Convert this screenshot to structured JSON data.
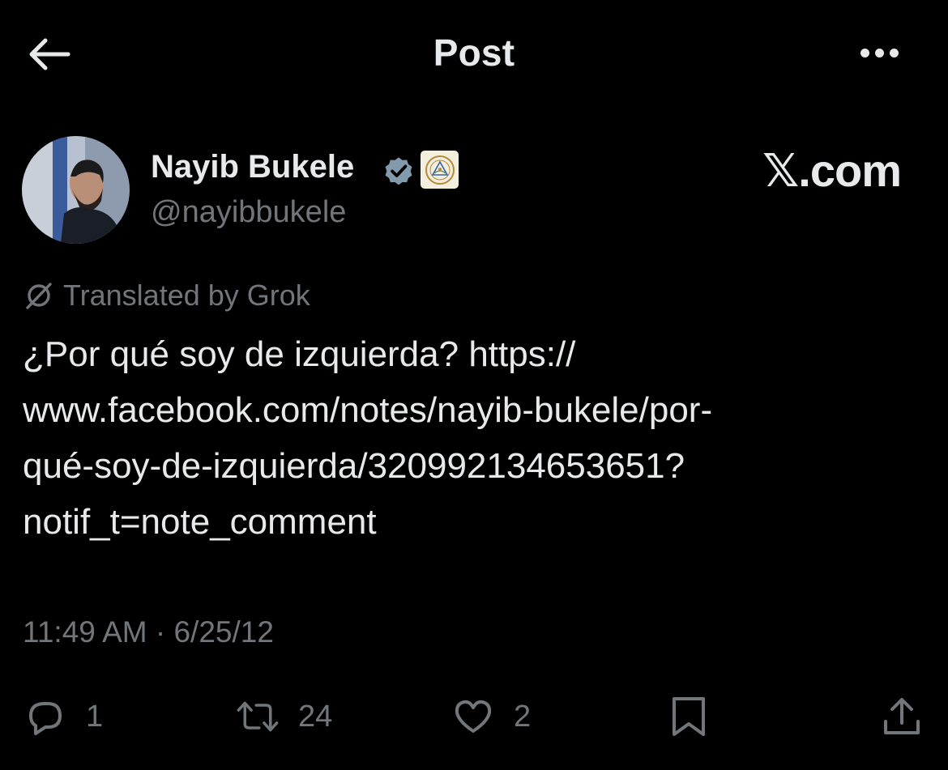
{
  "header": {
    "title": "Post",
    "back_icon": "arrow-left-icon",
    "more_icon": "more-horizontal-icon"
  },
  "author": {
    "name": "Nayib Bukele",
    "handle": "@nayibbukele",
    "verified_icon": "verified-badge-icon",
    "affiliation_badge": "government-seal-badge"
  },
  "watermark": {
    "text": "𝕏.com"
  },
  "translation": {
    "label": "Translated by Grok",
    "icon": "grok-icon"
  },
  "post": {
    "lines": [
      "¿Por qué soy de izquierda? https://",
      "www.facebook.com/notes/nayib-bukele/por-",
      "qué-soy-de-izquierda/320992134653651?",
      "notif_t=note_comment"
    ]
  },
  "timestamp": {
    "time": "11:49 AM",
    "separator": "·",
    "date": "6/25/12"
  },
  "actions": {
    "reply": {
      "icon": "reply-icon",
      "count": "1"
    },
    "repost": {
      "icon": "repost-icon",
      "count": "24"
    },
    "like": {
      "icon": "heart-icon",
      "count": "2"
    },
    "bookmark": {
      "icon": "bookmark-icon"
    },
    "share": {
      "icon": "share-icon"
    }
  },
  "colors": {
    "background": "#000000",
    "text_primary": "#e7e9ea",
    "text_secondary": "#71767b",
    "verified": "#829aab"
  }
}
